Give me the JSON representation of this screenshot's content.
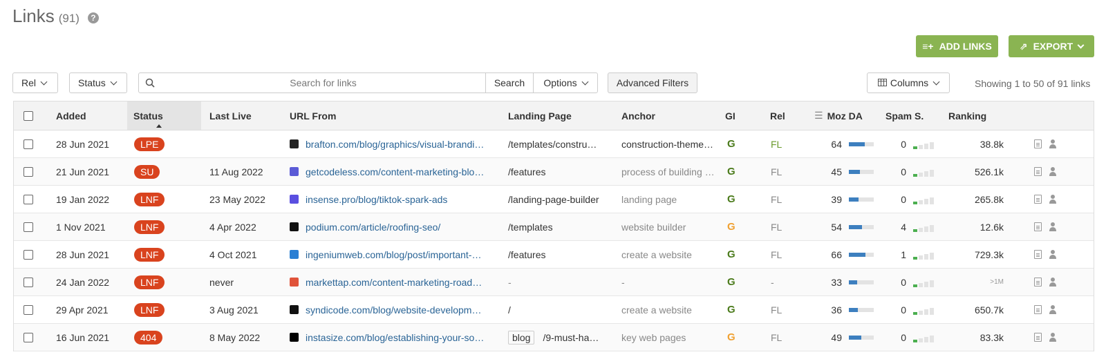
{
  "header": {
    "title": "Links",
    "count": "(91)",
    "help_icon": "question-circle-icon"
  },
  "actions": {
    "add_links": "ADD LINKS",
    "export": "EXPORT"
  },
  "toolbar": {
    "rel_label": "Rel",
    "status_label": "Status",
    "search_placeholder": "Search for links",
    "search_button": "Search",
    "options_label": "Options",
    "advanced_filters": "Advanced Filters",
    "columns_label": "Columns",
    "showing": "Showing 1 to 50 of 91 links"
  },
  "columns": [
    "Added",
    "Status",
    "Last Live",
    "URL From",
    "Landing Page",
    "Anchor",
    "GI",
    "Rel",
    "Moz DA",
    "Spam S.",
    "Ranking"
  ],
  "colors": {
    "accent_green": "#8ab452",
    "badge_red": "#d9431e",
    "link_blue": "#2a6496",
    "gi_green": "#4a7a1a",
    "gi_orange": "#f0a030"
  },
  "rows": [
    {
      "added": "28 Jun 2021",
      "status": "LPE",
      "last_live": "",
      "url": "brafton.com/blog/graphics/visual-brandi…",
      "favicon_color": "#222222",
      "landing_tag": "",
      "landing": "/templates/constru…",
      "anchor": "construction-theme…",
      "anchor_muted": false,
      "gi_color": "#4a7a1a",
      "rel": "FL",
      "rel_green": true,
      "moz_da": "64",
      "moz_fill": 0.64,
      "spam": "0",
      "ranking": "38.8k",
      "ranking_small": false
    },
    {
      "added": "21 Jun 2021",
      "status": "SU",
      "last_live": "11 Aug 2022",
      "url": "getcodeless.com/content-marketing-blo…",
      "favicon_color": "#5b5bd6",
      "landing_tag": "",
      "landing": "/features",
      "anchor": "process of building …",
      "anchor_muted": true,
      "gi_color": "#4a7a1a",
      "rel": "FL",
      "rel_green": false,
      "moz_da": "45",
      "moz_fill": 0.45,
      "spam": "0",
      "ranking": "526.1k",
      "ranking_small": false
    },
    {
      "added": "19 Jan 2022",
      "status": "LNF",
      "last_live": "23 May 2022",
      "url": "insense.pro/blog/tiktok-spark-ads",
      "favicon_color": "#5a4fe0",
      "landing_tag": "",
      "landing": "/landing-page-builder",
      "anchor": "landing page",
      "anchor_muted": true,
      "gi_color": "#4a7a1a",
      "rel": "FL",
      "rel_green": false,
      "moz_da": "39",
      "moz_fill": 0.39,
      "spam": "0",
      "ranking": "265.8k",
      "ranking_small": false
    },
    {
      "added": "1 Nov 2021",
      "status": "LNF",
      "last_live": "4 Apr 2022",
      "url": "podium.com/article/roofing-seo/",
      "favicon_color": "#111111",
      "landing_tag": "",
      "landing": "/templates",
      "anchor": "website builder",
      "anchor_muted": true,
      "gi_color": "#f0a030",
      "rel": "FL",
      "rel_green": false,
      "moz_da": "54",
      "moz_fill": 0.54,
      "spam": "4",
      "ranking": "12.6k",
      "ranking_small": false
    },
    {
      "added": "28 Jun 2021",
      "status": "LNF",
      "last_live": "4 Oct 2021",
      "url": "ingeniumweb.com/blog/post/important-…",
      "favicon_color": "#2a7fd4",
      "landing_tag": "",
      "landing": "/features",
      "anchor": "create a website",
      "anchor_muted": true,
      "gi_color": "#4a7a1a",
      "rel": "FL",
      "rel_green": false,
      "moz_da": "66",
      "moz_fill": 0.66,
      "spam": "1",
      "ranking": "729.3k",
      "ranking_small": false
    },
    {
      "added": "24 Jan 2022",
      "status": "LNF",
      "last_live": "never",
      "url": "markettap.com/content-marketing-road…",
      "favicon_color": "#e0533a",
      "landing_tag": "",
      "landing": "-",
      "anchor": "-",
      "anchor_muted": true,
      "gi_color": "#4a7a1a",
      "rel": "-",
      "rel_green": false,
      "moz_da": "33",
      "moz_fill": 0.33,
      "spam": "0",
      "ranking": ">1M",
      "ranking_small": true
    },
    {
      "added": "29 Apr 2021",
      "status": "LNF",
      "last_live": "3 Aug 2021",
      "url": "syndicode.com/blog/website-developm…",
      "favicon_color": "#111111",
      "landing_tag": "",
      "landing": "/",
      "anchor": "create a website",
      "anchor_muted": true,
      "gi_color": "#4a7a1a",
      "rel": "FL",
      "rel_green": false,
      "moz_da": "36",
      "moz_fill": 0.36,
      "spam": "0",
      "ranking": "650.7k",
      "ranking_small": false
    },
    {
      "added": "16 Jun 2021",
      "status": "404",
      "last_live": "8 May 2022",
      "url": "instasize.com/blog/establishing-your-so…",
      "favicon_color": "#000000",
      "landing_tag": "blog",
      "landing": "/9-must-ha…",
      "anchor": "key web pages",
      "anchor_muted": true,
      "gi_color": "#f0a030",
      "rel": "FL",
      "rel_green": false,
      "moz_da": "49",
      "moz_fill": 0.49,
      "spam": "0",
      "ranking": "83.3k",
      "ranking_small": false
    }
  ]
}
